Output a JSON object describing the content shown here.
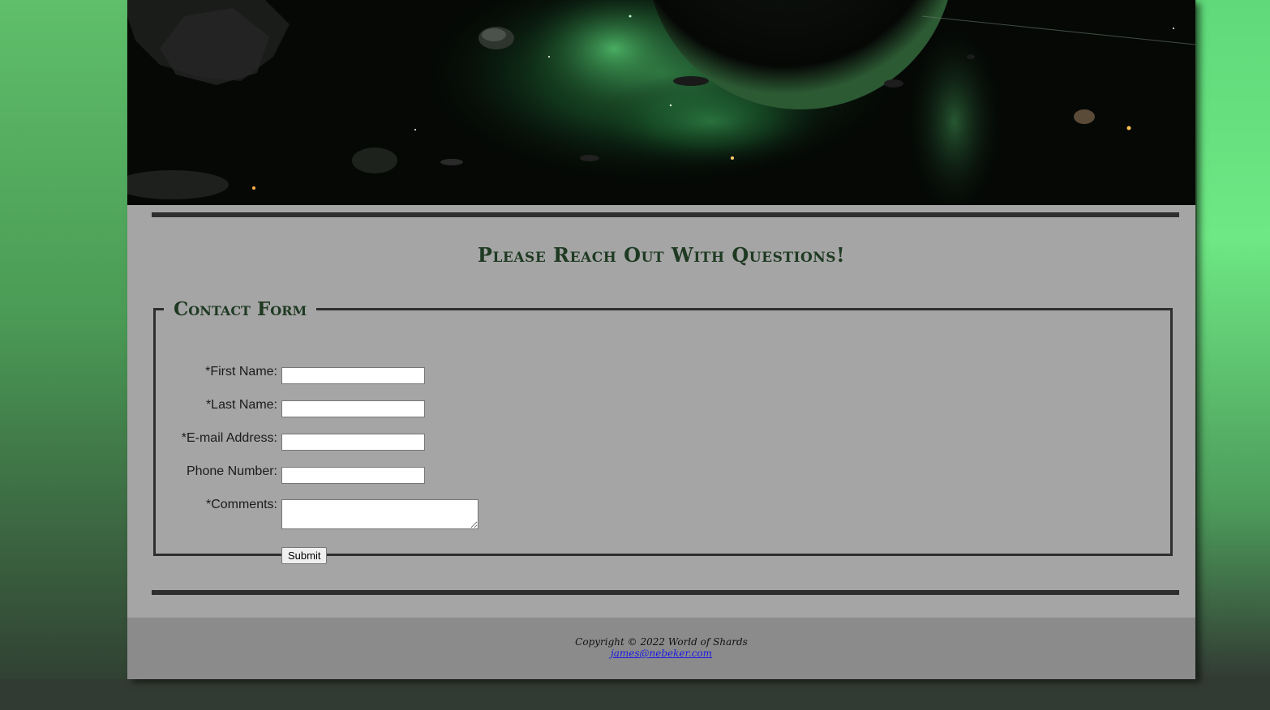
{
  "header": {
    "banner_image": "space-nebula-planet-asteroids"
  },
  "main": {
    "heading": "Please Reach Out With Questions!",
    "form": {
      "legend": "Contact Form",
      "fields": {
        "first_name": {
          "label": "*First Name:",
          "value": ""
        },
        "last_name": {
          "label": "*Last Name:",
          "value": ""
        },
        "email": {
          "label": "*E-mail Address:",
          "value": ""
        },
        "phone": {
          "label": "Phone Number:",
          "value": ""
        },
        "comments": {
          "label": "*Comments:",
          "value": ""
        }
      },
      "submit_label": "Submit"
    }
  },
  "footer": {
    "copyright": "Copyright © 2022 World of Shards",
    "email_link": "james@nebeker.com"
  },
  "colors": {
    "background_green": "#5fbf6a",
    "page_gray": "#a5a5a5",
    "footer_gray": "#8b8b8b",
    "heading_green": "#1e3a22",
    "rule_dark": "#2f2f2f"
  }
}
